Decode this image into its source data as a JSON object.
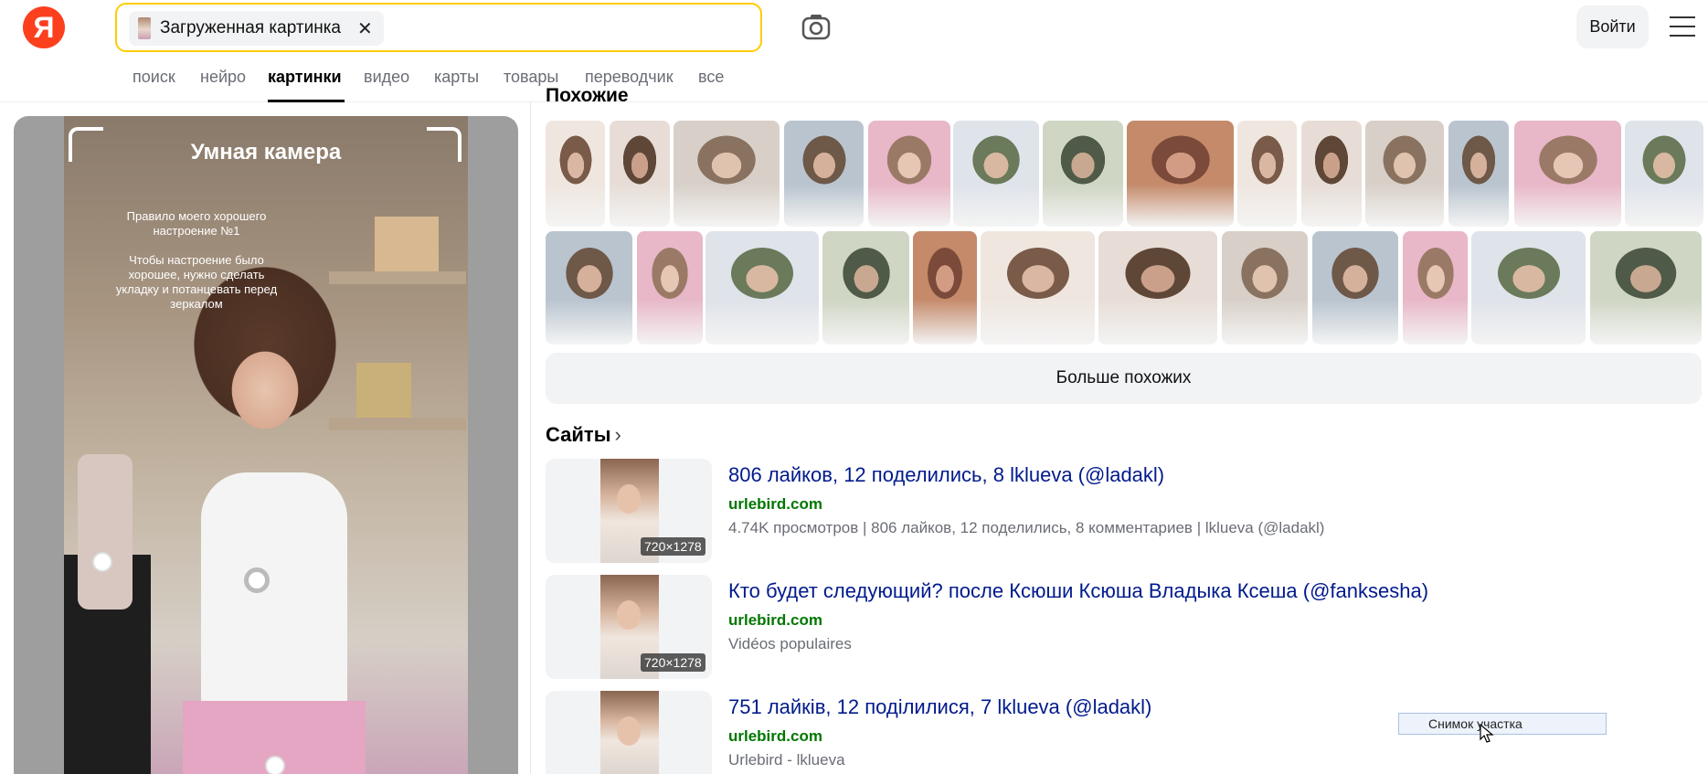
{
  "header": {
    "logo_letter": "Я",
    "search_chip_label": "Загруженная картинка",
    "search_chip_close": "✕",
    "login_label": "Войти"
  },
  "tabs": [
    {
      "label": "поиск"
    },
    {
      "label": "нейро"
    },
    {
      "label": "картинки",
      "active": true
    },
    {
      "label": "видео"
    },
    {
      "label": "карты"
    },
    {
      "label": "товары"
    },
    {
      "label": "переводчик"
    },
    {
      "label": "все"
    }
  ],
  "preview": {
    "title": "Умная камера",
    "note_line1": "Правило моего хорошего настроение №1",
    "note_line2": "Чтобы настроение было хорошее, нужно сделать укладку и потанцевать перед зеркалом"
  },
  "similar": {
    "title": "Похожие",
    "more_label": "Больше похожих"
  },
  "sites": {
    "title": "Сайты",
    "chevron": "›",
    "items": [
      {
        "title": "806 лайков, 12 поделились, 8 lklueva (@ladakl)",
        "host": "urlebird.com",
        "desc": "4.74K просмотров | 806 лайков, 12 поделились, 8 комментариев | lklueva (@ladakl)",
        "size": "720×1278"
      },
      {
        "title": "Кто будет следующий? после Ксюши Ксюша Владыка Ксеша (@fanksesha)",
        "host": "urlebird.com",
        "desc": "Vidéos populaires",
        "size": "720×1278"
      },
      {
        "title": "751 лайків, 12 поділилися, 7 lklueva (@ladakl)",
        "host": "urlebird.com",
        "desc": "Urlebird - lklueva",
        "size": ""
      }
    ]
  },
  "tooltip": {
    "label": "Снимок участка"
  },
  "colors": {
    "accent_yellow": "#ffcc00",
    "logo_red": "#fc3f1d",
    "link_blue": "#001a8c",
    "host_green": "#007700"
  }
}
